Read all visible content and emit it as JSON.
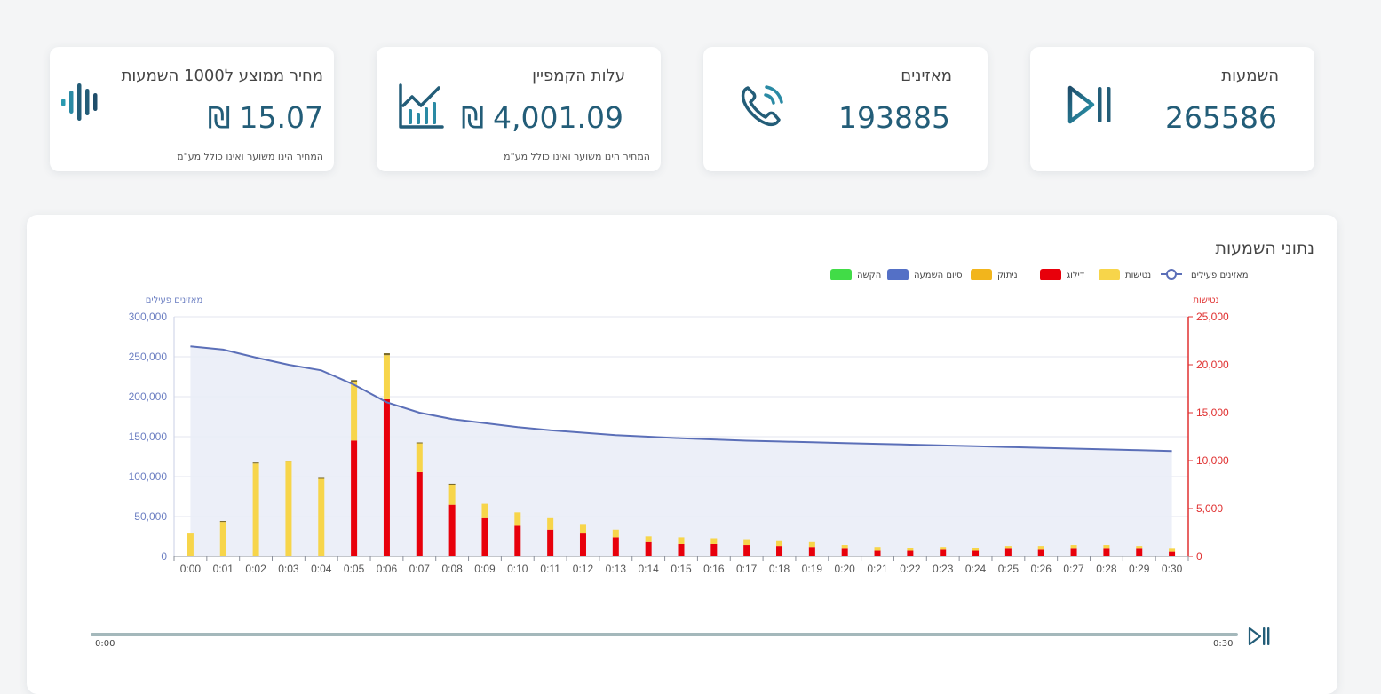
{
  "cards": [
    {
      "title": "השמעות",
      "value": "265586",
      "icon": "play-pause-icon"
    },
    {
      "title": "מאזינים",
      "value": "193885",
      "icon": "phone-call-icon"
    },
    {
      "title": "עלות הקמפיין",
      "value": "4,001.09",
      "currency": "₪",
      "note": "המחיר הינו משוער ואינו כולל מע\"מ",
      "icon": "bar-chart-trend-icon"
    },
    {
      "title": "מחיר ממוצע ל1000 השמעות",
      "value": "15.07",
      "currency": "₪",
      "note": "המחיר הינו משוער ואינו כולל מע\"מ",
      "icon": "sound-wave-icon"
    }
  ],
  "panel": {
    "title": "נתוני השמעות"
  },
  "player": {
    "start": "0:00",
    "end": "0:30",
    "icon": "play-pause-icon"
  },
  "colors": {
    "brand": "#235d78",
    "active_line": "#5b6fb8",
    "active_fill": "#e9ecf7",
    "hangup": "#f7d54a",
    "skip": "#e8000b",
    "disconnect": "#f2b51c",
    "finish": "#5470c6",
    "press": "#41dc47",
    "left_axis": "#6c7fc2",
    "right_axis": "#e03030"
  },
  "chart_data": {
    "type": "bar+line",
    "legend": [
      {
        "name": "הקשה",
        "color": "#41dc47"
      },
      {
        "name": "סיום השמעה",
        "color": "#5470c6"
      },
      {
        "name": "ניתוק",
        "color": "#f2b51c"
      },
      {
        "name": "דילוג",
        "color": "#e8000b"
      },
      {
        "name": "נטישות",
        "color": "#f7d54a"
      },
      {
        "name": "מאזינים פעילים",
        "color": "#5b6fb8",
        "style": "line"
      }
    ],
    "legend_position": "top-center",
    "left_axis": {
      "label": "מאזינים פעילים",
      "min": 0,
      "max": 300000,
      "ticks": [
        "0",
        "50,000",
        "100,000",
        "150,000",
        "200,000",
        "250,000",
        "300,000"
      ]
    },
    "right_axis": {
      "label": "נטישות",
      "min": 0,
      "max": 25000,
      "ticks": [
        "0",
        "5,000",
        "10,000",
        "15,000",
        "20,000",
        "25,000"
      ]
    },
    "x": [
      "0:00",
      "0:01",
      "0:02",
      "0:03",
      "0:04",
      "0:05",
      "0:06",
      "0:07",
      "0:08",
      "0:09",
      "0:10",
      "0:11",
      "0:12",
      "0:13",
      "0:14",
      "0:15",
      "0:16",
      "0:17",
      "0:18",
      "0:19",
      "0:20",
      "0:21",
      "0:22",
      "0:23",
      "0:24",
      "0:25",
      "0:26",
      "0:27",
      "0:28",
      "0:29",
      "0:30"
    ],
    "series": [
      {
        "name": "מאזינים פעילים",
        "axis": "left",
        "type": "area-line",
        "values": [
          263000,
          259000,
          249000,
          240000,
          233000,
          215000,
          193000,
          180000,
          172000,
          167000,
          162000,
          158000,
          155000,
          152000,
          150000,
          148000,
          146500,
          145000,
          144000,
          143000,
          142000,
          141000,
          140000,
          139000,
          138000,
          137000,
          136000,
          135000,
          134000,
          133000,
          132000
        ]
      },
      {
        "name": "דילוג",
        "axis": "right",
        "type": "bar",
        "values": [
          0,
          0,
          0,
          0,
          0,
          12100,
          16400,
          8800,
          5400,
          4000,
          3200,
          2800,
          2400,
          2000,
          1500,
          1300,
          1300,
          1200,
          1100,
          1000,
          800,
          600,
          600,
          700,
          600,
          800,
          700,
          800,
          800,
          800,
          500
        ]
      },
      {
        "name": "נטישות",
        "axis": "right",
        "type": "bar",
        "values": [
          2400,
          3600,
          9700,
          9900,
          8100,
          6100,
          4600,
          3000,
          2100,
          1500,
          1400,
          1200,
          900,
          800,
          600,
          700,
          600,
          600,
          500,
          500,
          400,
          400,
          300,
          300,
          300,
          300,
          400,
          400,
          400,
          300,
          300
        ]
      },
      {
        "name": "ניתוק",
        "axis": "right",
        "type": "bar",
        "values": [
          0,
          100,
          100,
          100,
          100,
          200,
          200,
          100,
          100,
          0,
          0,
          0,
          0,
          0,
          0,
          0,
          0,
          0,
          0,
          0,
          0,
          0,
          0,
          0,
          0,
          0,
          0,
          0,
          0,
          0,
          0
        ]
      }
    ]
  }
}
